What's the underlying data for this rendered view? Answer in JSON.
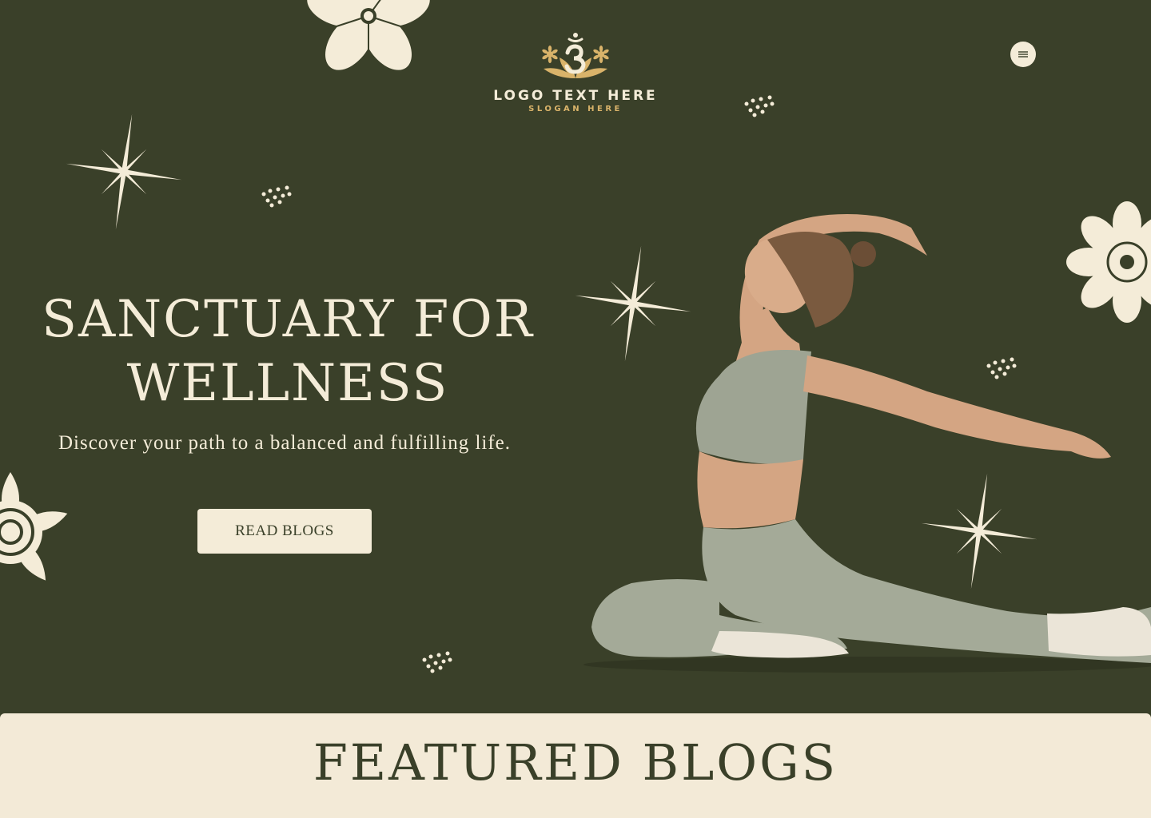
{
  "header": {
    "logo_text": "LOGO TEXT HERE",
    "slogan": "SLOGAN HERE",
    "logo_icon": "om-lotus-icon",
    "menu_icon": "hamburger-menu-icon"
  },
  "hero": {
    "title_line1": "SANCTUARY FOR",
    "title_line2": "WELLNESS",
    "subtitle": "Discover your path to a balanced and fulfilling life.",
    "cta_label": "READ BLOGS",
    "image": "yoga-woman-photo"
  },
  "featured": {
    "title": "FEATURED BLOGS"
  },
  "colors": {
    "background": "#3a4029",
    "cream": "#f4ecd8",
    "gold": "#d9b36a",
    "section_bg": "#f3ead7"
  }
}
